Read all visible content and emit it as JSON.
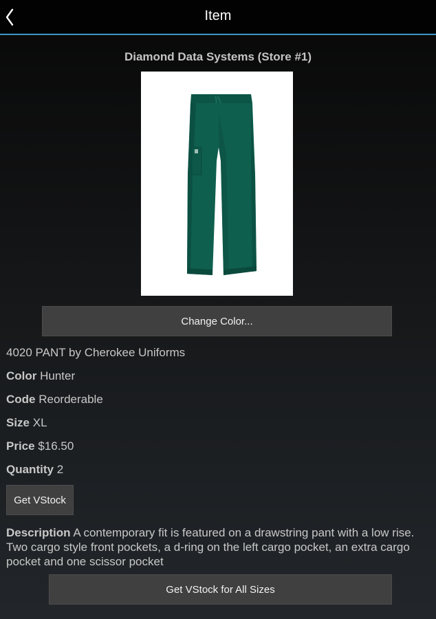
{
  "header": {
    "title": "Item",
    "back_icon": "chevron-left-icon"
  },
  "store": {
    "name": "Diamond Data Systems (Store #1)"
  },
  "product": {
    "image_alt": "Hunter green cargo pant",
    "title": "4020 PANT by Cherokee Uniforms",
    "fields": {
      "color_label": "Color",
      "color_value": "Hunter",
      "code_label": "Code",
      "code_value": "Reorderable",
      "size_label": "Size",
      "size_value": "XL",
      "price_label": "Price",
      "price_value": "$16.50",
      "quantity_label": "Quantity",
      "quantity_value": "2"
    },
    "description_label": "Description",
    "description_text": "A contemporary fit is featured on a drawstring pant with a low rise. Two cargo style front pockets, a d-ring on the left cargo pocket, an extra cargo pocket and one scissor pocket"
  },
  "buttons": {
    "change_color": "Change Color...",
    "get_vstock": "Get VStock",
    "get_vstock_all": "Get VStock for All Sizes"
  },
  "colors": {
    "accent_line": "#3e96c4",
    "pant_green": "#0f5f4e",
    "button_bg": "#404040"
  }
}
